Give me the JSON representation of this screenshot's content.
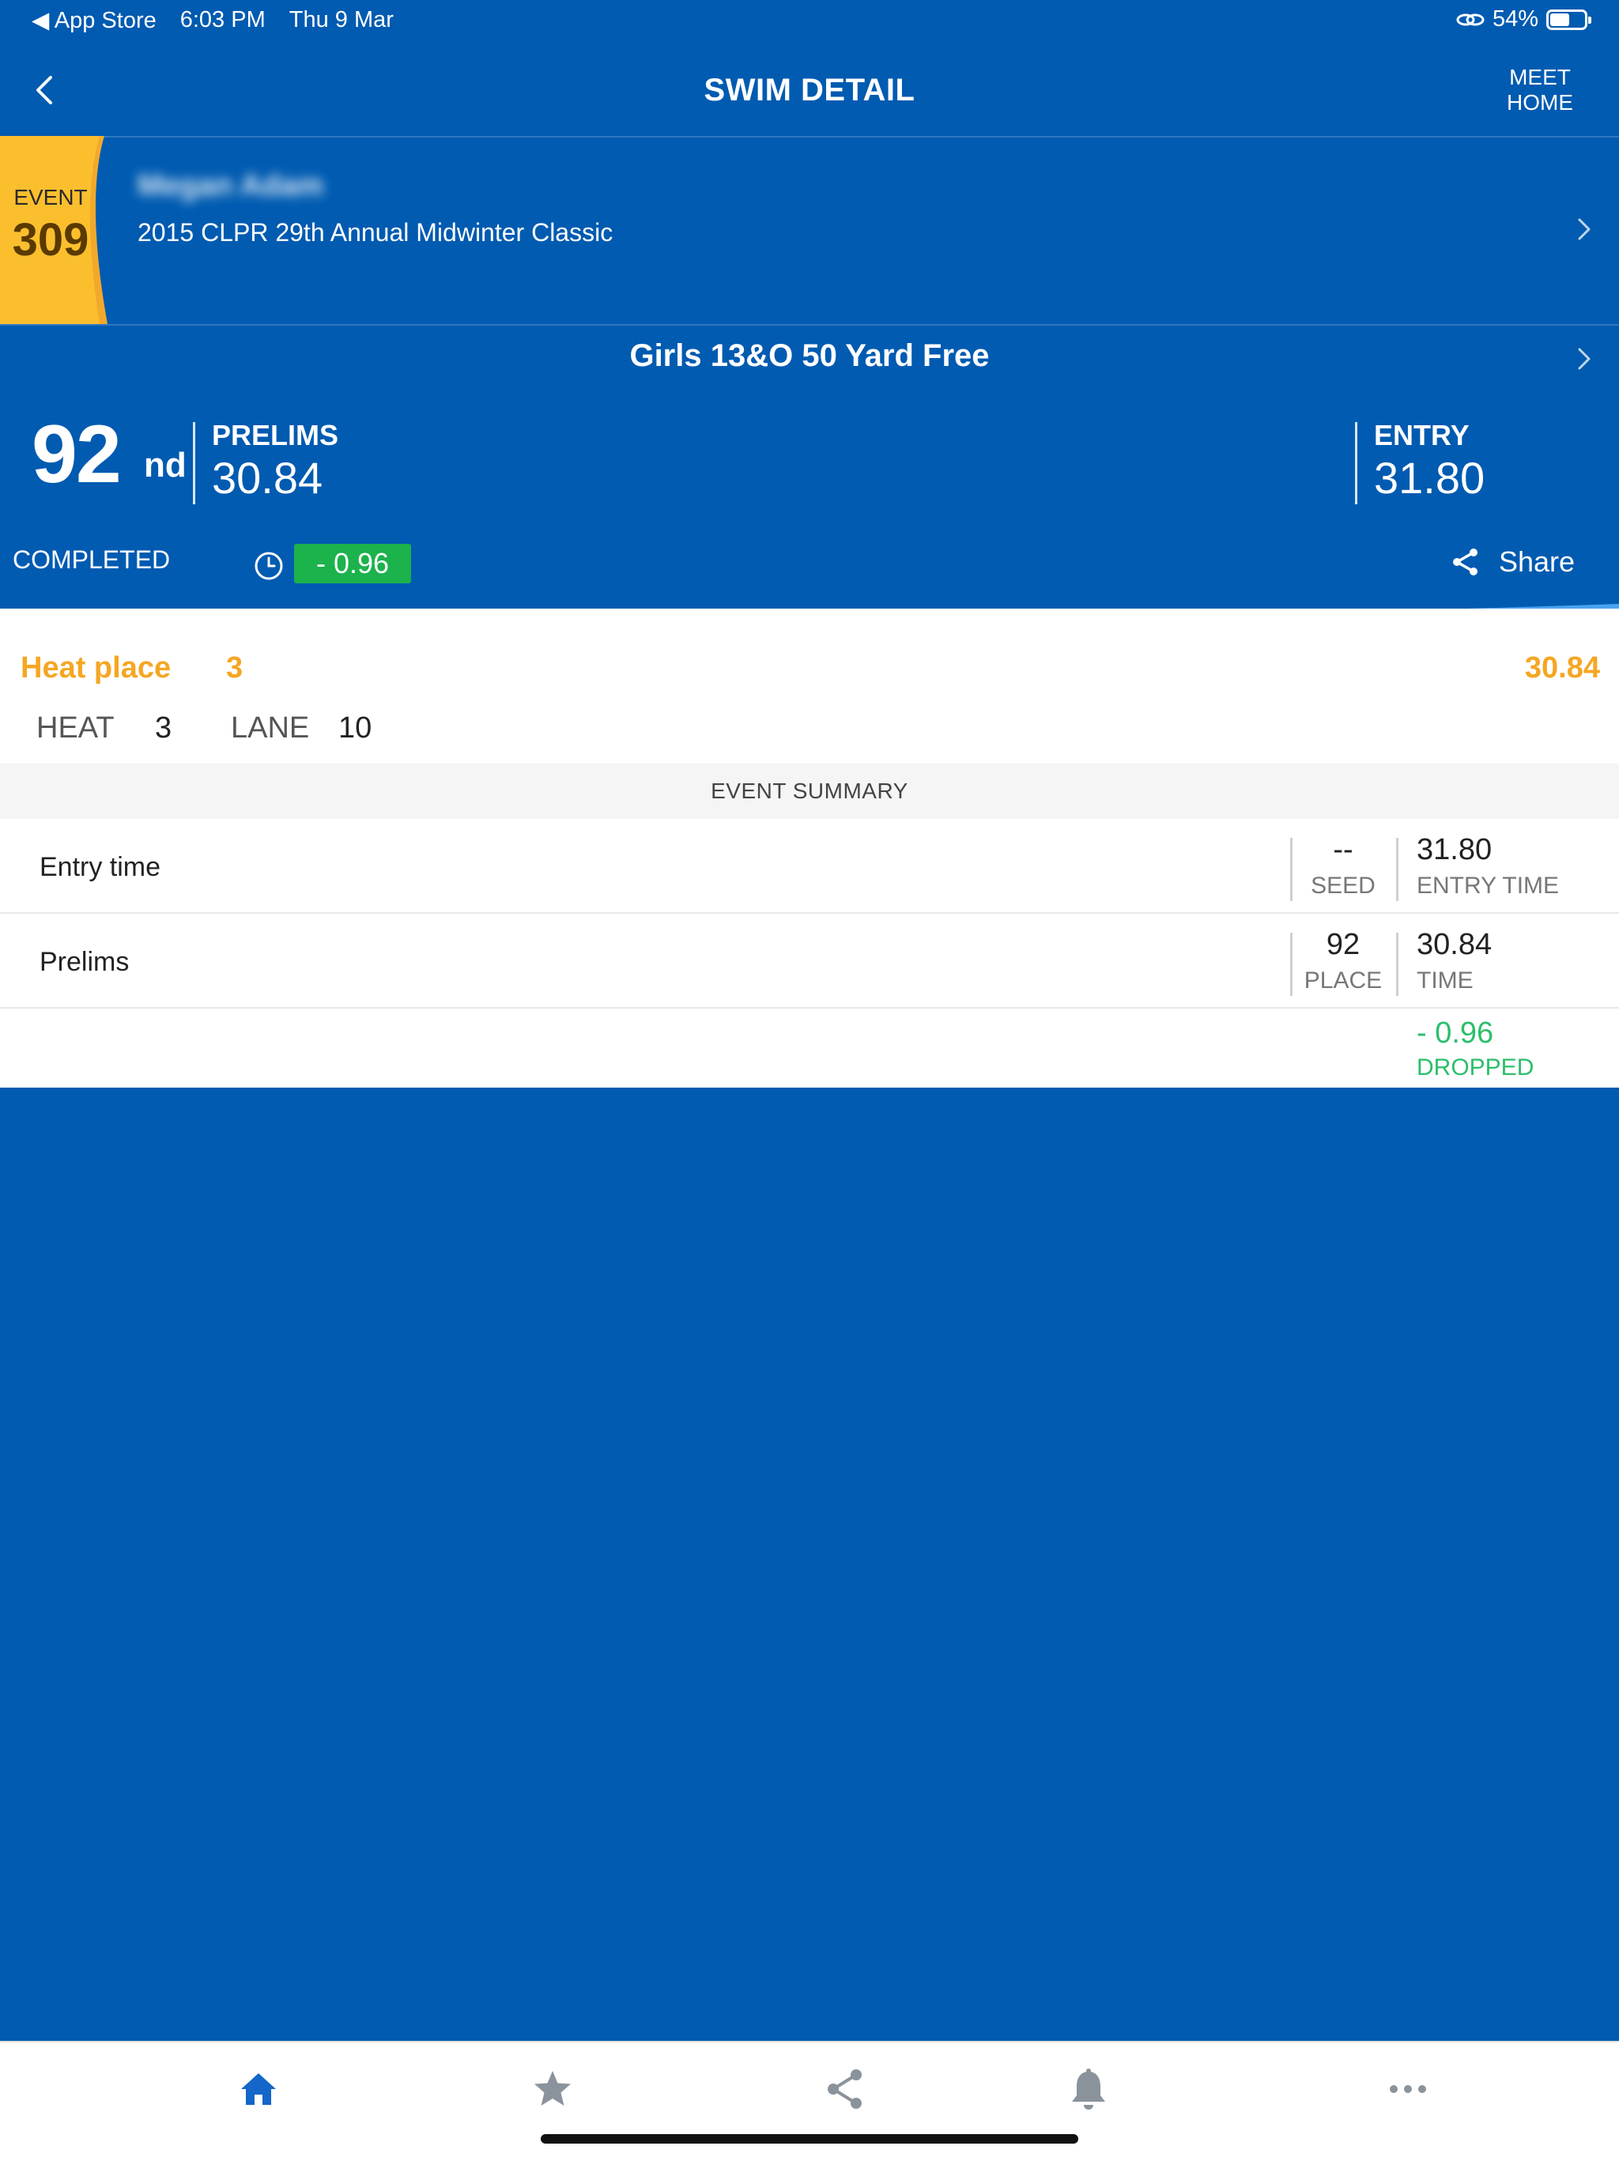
{
  "status_bar": {
    "back_app": "◀ App Store",
    "time": "6:03 PM",
    "date": "Thu 9 Mar",
    "battery_percent": "54%",
    "battery_level": 0.54
  },
  "nav": {
    "title": "SWIM DETAIL",
    "meet_home_line1": "MEET",
    "meet_home_line2": "HOME"
  },
  "swimmer": {
    "event_label": "EVENT",
    "event_number": "309",
    "name": "Megan Adam",
    "meet_name": "2015 CLPR 29th Annual Midwinter Classic"
  },
  "event": {
    "title": "Girls 13&O 50 Yard Free"
  },
  "result": {
    "place": "92",
    "place_suffix": "nd",
    "prelims_label": "PRELIMS",
    "prelims_time": "30.84",
    "entry_label": "ENTRY",
    "entry_time": "31.80",
    "status": "COMPLETED",
    "time_drop": "- 0.96",
    "share_label": "Share"
  },
  "heat": {
    "heat_place_label": "Heat place",
    "heat_place_value": "3",
    "time": "30.84",
    "heat_label": "HEAT",
    "heat_value": "3",
    "lane_label": "LANE",
    "lane_value": "10"
  },
  "summary": {
    "header": "EVENT SUMMARY",
    "rows": [
      {
        "label": "Entry time",
        "col1_value": "--",
        "col1_caption": "SEED",
        "col2_value": "31.80",
        "col2_caption": "ENTRY TIME"
      },
      {
        "label": "Prelims",
        "col1_value": "92",
        "col1_caption": "PLACE",
        "col2_value": "30.84",
        "col2_caption": "TIME"
      },
      {
        "label": "",
        "col2_value": "- 0.96",
        "col2_caption": "DROPPED"
      }
    ]
  },
  "tabs": [
    {
      "name": "home",
      "icon": "home-icon",
      "active": true
    },
    {
      "name": "favorites",
      "icon": "star-icon",
      "active": false
    },
    {
      "name": "share",
      "icon": "share-icon",
      "active": false
    },
    {
      "name": "notifications",
      "icon": "bell-icon",
      "active": false
    },
    {
      "name": "more",
      "icon": "more-icon",
      "active": false
    }
  ],
  "colors": {
    "primary_blue": "#005bb1",
    "accent_yellow": "#fbbf2e",
    "accent_orange": "#f5a623",
    "drop_green": "#1cb24c",
    "active_tab": "#1466c8",
    "inactive_tab": "#8a939b"
  }
}
